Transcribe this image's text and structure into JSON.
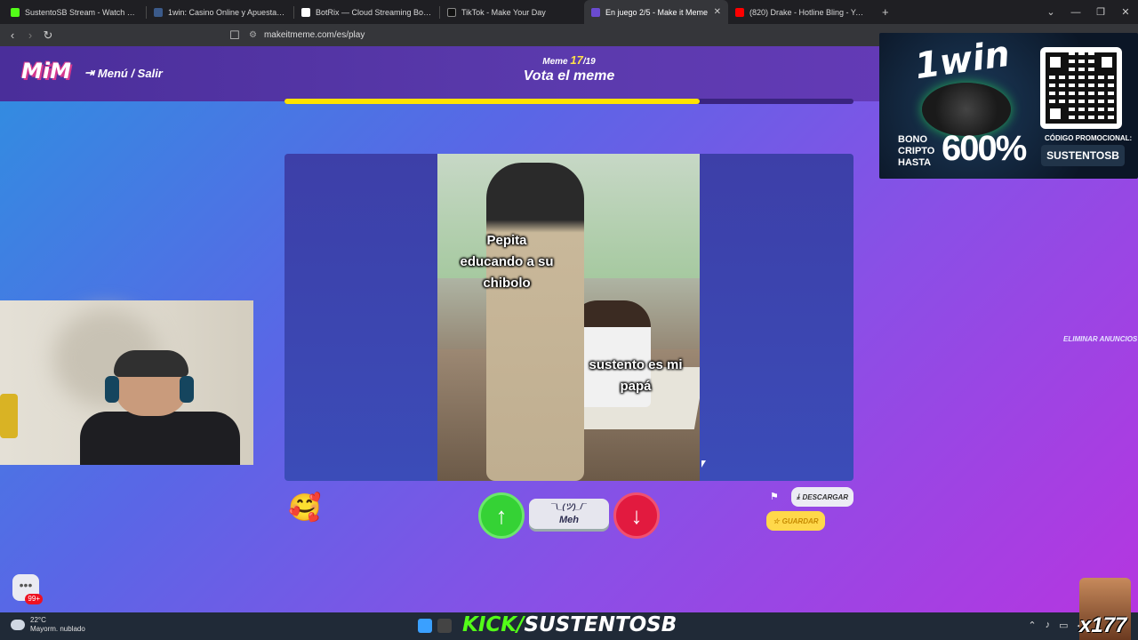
{
  "browser": {
    "tabs": [
      {
        "title": "SustentoSB Stream - Watch Live",
        "color": "#53fc18",
        "active": false
      },
      {
        "title": "1win: Casino Online y Apuestas Depo",
        "color": "#3b5a8a",
        "active": false
      },
      {
        "title": "BotRix — Cloud Streaming Bot for Tw",
        "color": "#ffffff",
        "active": false
      },
      {
        "title": "TikTok - Make Your Day",
        "color": "#111111",
        "active": false
      },
      {
        "title": "En juego 2/5 - Make it Meme",
        "color": "#4a2e9a",
        "active": true
      },
      {
        "title": "(820) Drake - Hotline Bling - YouT",
        "color": "#ff0000",
        "active": false
      }
    ],
    "url": "makeitmeme.com/es/play"
  },
  "app": {
    "logo": "MiM",
    "menu_label": "Menú / Salir",
    "meme_label": "Meme",
    "meme_current": "17",
    "meme_total": "/19",
    "title": "Vota el meme",
    "progress": 0.73
  },
  "meme": {
    "caption_top": "Pepita educando a su chibolo",
    "caption_bottom": "sustento es mi papá"
  },
  "vote": {
    "up_icon": "arrow-up-icon",
    "meh_face": "¯\\_(ツ)_/¯",
    "meh_label": "Meh",
    "down_icon": "arrow-down-icon"
  },
  "actions": {
    "download_label": "DESCARGAR",
    "save_label": "GUARDAR"
  },
  "sidebar_link": "ELIMINAR ANUNCIOS",
  "chat_badge": "99+",
  "ad": {
    "brand": "1win",
    "bono_lines": "BONO CRIPTO HASTA",
    "percent": "600%",
    "code_label": "CÓDIGO PROMOCIONAL:",
    "code": "SUSTENTOSB"
  },
  "taskbar": {
    "temp": "22°C",
    "weather": "Mayorm. nublado",
    "overlay_k": "KICK/",
    "overlay_name": "SUSTENTOSB"
  },
  "overlay_badge": "x177",
  "colors": {
    "accent_yellow": "#ffe300",
    "up_green": "#35d235",
    "down_red": "#e21a3f",
    "kick_green": "#53fc18"
  }
}
